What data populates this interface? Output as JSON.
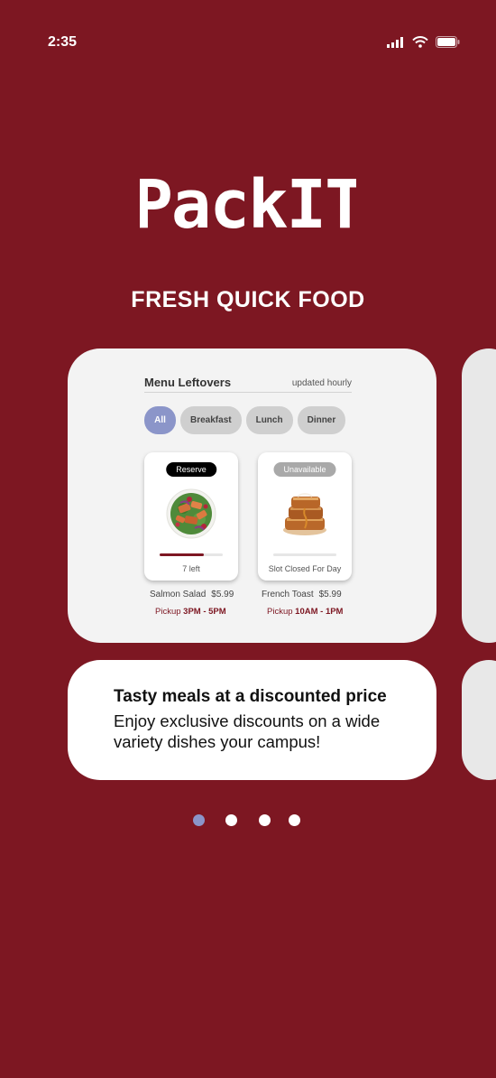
{
  "status_bar": {
    "time": "2:35",
    "signal_icon": "cellular-signal-icon",
    "wifi_icon": "wifi-icon",
    "battery_icon": "battery-icon"
  },
  "app": {
    "logo_text": "PackIT",
    "tagline": "FRESH QUICK FOOD"
  },
  "menu": {
    "title": "Menu Leftovers",
    "updated": "updated hourly",
    "filters": [
      {
        "label": "All",
        "active": true
      },
      {
        "label": "Breakfast",
        "active": false
      },
      {
        "label": "Lunch",
        "active": false
      },
      {
        "label": "Dinner",
        "active": false
      }
    ],
    "items": [
      {
        "badge": "Reserve",
        "status": "7 left",
        "stock_fraction": 0.7,
        "name": "Salmon Salad",
        "price": "$5.99",
        "pickup_label": "Pickup",
        "pickup_time": "3PM - 5PM",
        "image": "salmon-salad-image"
      },
      {
        "badge": "Unavailable",
        "status": "Slot Closed For Day",
        "stock_fraction": 0,
        "name": "French Toast",
        "price": "$5.99",
        "pickup_label": "Pickup",
        "pickup_time": "10AM - 1PM",
        "image": "french-toast-image"
      }
    ]
  },
  "feature": {
    "title": "Tasty meals at a discounted price",
    "body": "Enjoy exclusive discounts on a wide variety dishes your campus!"
  },
  "pagination": {
    "total": 4,
    "active_index": 0
  },
  "colors": {
    "brand": "#7d1722",
    "accent": "#8b95c9",
    "card": "#f3f3f3",
    "white": "#ffffff"
  }
}
